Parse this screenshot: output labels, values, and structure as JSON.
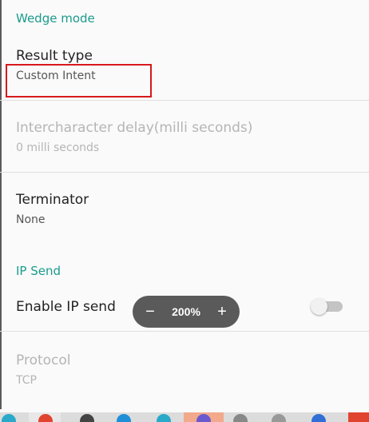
{
  "sections": {
    "wedge_mode": "Wedge mode",
    "ip_send": "IP Send"
  },
  "prefs": {
    "result_type": {
      "title": "Result type",
      "summary": "Custom Intent"
    },
    "intercharacter_delay": {
      "title": "Intercharacter delay(milli seconds)",
      "summary": "0 milli seconds",
      "enabled": false
    },
    "terminator": {
      "title": "Terminator",
      "summary": "None"
    },
    "enable_ip_send": {
      "title": "Enable IP send",
      "checked": false
    },
    "protocol": {
      "title": "Protocol",
      "summary": "TCP",
      "enabled": false
    }
  },
  "zoom": {
    "minus": "−",
    "level": "200%",
    "plus": "+"
  },
  "colors": {
    "accent": "#1a9c8c",
    "highlight": "#d7191c",
    "zoom_bg": "#5a5a5a"
  }
}
